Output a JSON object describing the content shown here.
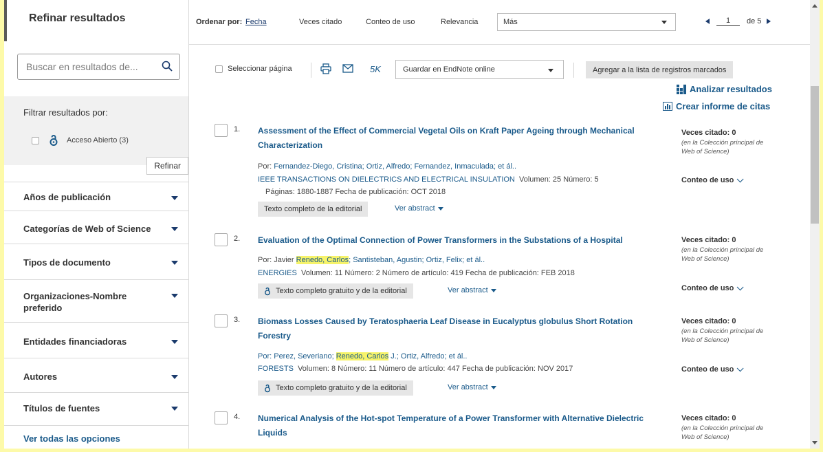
{
  "sidebar": {
    "title": "Refinar resultados",
    "search_placeholder": "Buscar en resultados de...",
    "filter_title": "Filtrar resultados por:",
    "open_access_label": "Acceso Abierto (3)",
    "refine_button": "Refinar",
    "facets": [
      "Años de publicación",
      "Categorías de Web of Science",
      "Tipos de documento",
      "Organizaciones-Nombre preferido",
      "Entidades financiadoras",
      "Autores",
      "Títulos de fuentes"
    ],
    "see_all": "Ver todas las opciones"
  },
  "sortbar": {
    "label": "Ordenar por:",
    "options": [
      "Fecha",
      "Veces citado",
      "Conteo de uso",
      "Relevancia"
    ],
    "active": "Fecha",
    "more_select": "Más",
    "page_current": "1",
    "page_of": "de 5"
  },
  "toolbar": {
    "select_page": "Seleccionar página",
    "k_label": "5K",
    "endnote_select": "Guardar en EndNote online",
    "marked_button": "Agregar a la lista de registros marcados"
  },
  "links": {
    "analyze": "Analizar resultados",
    "citation_report": "Crear informe de citas"
  },
  "records": [
    {
      "num": "1.",
      "title": "Assessment of the Effect of Commercial Vegetal Oils on Kraft Paper Ageing through Mechanical Characterization",
      "by": "Por:",
      "authors": "Fernandez-Diego, Cristina; Ortiz, Alfredo; Fernandez, Inmaculada; et ál..",
      "source": "IEEE TRANSACTIONS ON DIELECTRICS AND ELECTRICAL INSULATION",
      "details": "Volumen: 25  Número: 5",
      "details2": "Páginas: 1880-1887  Fecha de publicación: OCT 2018",
      "full_text": "Texto completo de la editorial",
      "abstract": "Ver abstract",
      "times_cited": "Veces citado: 0",
      "cited_note": "(en la Colección principal de Web of Science)",
      "usage": "Conteo de uso"
    },
    {
      "num": "2.",
      "title": "Evaluation of the Optimal Connection of Power Transformers in the Substations of a Hospital",
      "by": "Por: Javier",
      "highlight": "Renedo, Carlos",
      "authors_after": "; Santisteban, Agustin; Ortiz, Felix; et ál..",
      "source": "ENERGIES",
      "details": "Volumen: 11  Número: 2   Número de artículo: 419  Fecha de publicación: FEB 2018",
      "full_text": "Texto completo gratuito y de la editorial",
      "abstract": "Ver abstract",
      "times_cited": "Veces citado: 0",
      "cited_note": "(en la Colección principal de Web of Science)",
      "usage": "Conteo de uso"
    },
    {
      "num": "3.",
      "title": "Biomass Losses Caused by Teratosphaeria Leaf Disease in Eucalyptus globulus Short Rotation Forestry",
      "by": "Por: Perez, Severiano;",
      "highlight": "Renedo, Carlos",
      "authors_after": " J.; Ortiz, Alfredo; et ál..",
      "source": "FORESTS",
      "details": "Volumen: 8  Número: 11   Número de artículo: 447  Fecha de publicación: NOV 2017",
      "full_text": "Texto completo gratuito y de la editorial",
      "abstract": "Ver abstract",
      "times_cited": "Veces citado: 0",
      "cited_note": "(en la Colección principal de Web of Science)",
      "usage": "Conteo de uso"
    },
    {
      "num": "4.",
      "title": "Numerical Analysis of the Hot-spot Temperature of a Power Transformer with Alternative Dielectric Liquids",
      "times_cited": "Veces citado: 0",
      "cited_note": "(en la Colección principal de Web of Science)"
    }
  ],
  "colors": {
    "background_outer": "#fdfaa9",
    "link_blue": "#1a5a8a",
    "highlight": "#f6f36a"
  }
}
